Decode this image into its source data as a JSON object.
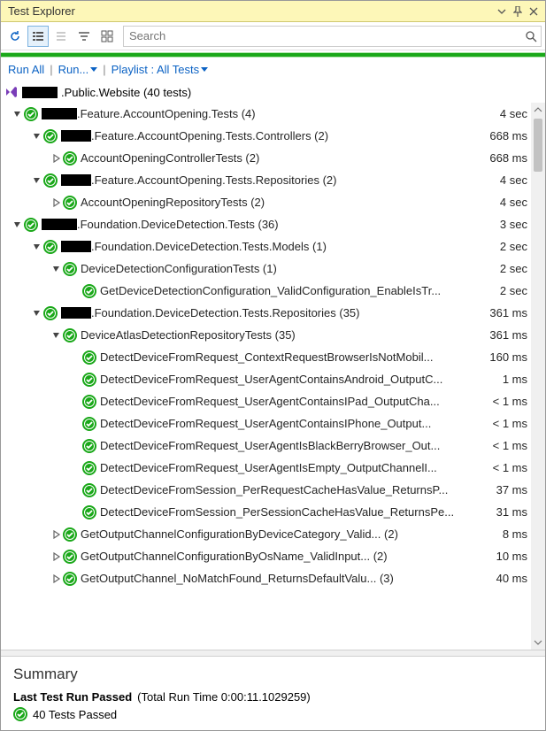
{
  "window": {
    "title": "Test Explorer"
  },
  "search": {
    "placeholder": "Search"
  },
  "linkbar": {
    "runAll": "Run All",
    "run": "Run...",
    "playlist": "Playlist : All Tests"
  },
  "project": {
    "suffix": ".Public.Website (40 tests)"
  },
  "rows": [
    {
      "exp": "open",
      "depth": 0,
      "blackW": 40,
      "text": ".Feature.AccountOpening.Tests (4)",
      "time": "4 sec"
    },
    {
      "exp": "open",
      "depth": 1,
      "blackW": 34,
      "text": ".Feature.AccountOpening.Tests.Controllers (2)",
      "time": "668 ms"
    },
    {
      "exp": "closed",
      "depth": 2,
      "blackW": 0,
      "text": "AccountOpeningControllerTests (2)",
      "time": "668 ms"
    },
    {
      "exp": "open",
      "depth": 1,
      "blackW": 34,
      "text": ".Feature.AccountOpening.Tests.Repositories (2)",
      "time": "4 sec"
    },
    {
      "exp": "closed",
      "depth": 2,
      "blackW": 0,
      "text": "AccountOpeningRepositoryTests (2)",
      "time": "4 sec"
    },
    {
      "exp": "open",
      "depth": 0,
      "blackW": 40,
      "text": ".Foundation.DeviceDetection.Tests (36)",
      "time": "3 sec"
    },
    {
      "exp": "open",
      "depth": 1,
      "blackW": 34,
      "text": ".Foundation.DeviceDetection.Tests.Models (1)",
      "time": "2 sec"
    },
    {
      "exp": "open",
      "depth": 2,
      "blackW": 0,
      "text": "DeviceDetectionConfigurationTests (1)",
      "time": "2 sec"
    },
    {
      "exp": "none",
      "depth": 3,
      "blackW": 0,
      "text": "GetDeviceDetectionConfiguration_ValidConfiguration_EnableIsTr...",
      "time": "2 sec"
    },
    {
      "exp": "open",
      "depth": 1,
      "blackW": 34,
      "text": ".Foundation.DeviceDetection.Tests.Repositories (35)",
      "time": "361 ms"
    },
    {
      "exp": "open",
      "depth": 2,
      "blackW": 0,
      "text": "DeviceAtlasDetectionRepositoryTests (35)",
      "time": "361 ms"
    },
    {
      "exp": "none",
      "depth": 3,
      "blackW": 0,
      "text": "DetectDeviceFromRequest_ContextRequestBrowserIsNotMobil...",
      "time": "160 ms"
    },
    {
      "exp": "none",
      "depth": 3,
      "blackW": 0,
      "text": "DetectDeviceFromRequest_UserAgentContainsAndroid_OutputC...",
      "time": "1 ms"
    },
    {
      "exp": "none",
      "depth": 3,
      "blackW": 0,
      "text": "DetectDeviceFromRequest_UserAgentContainsIPad_OutputCha...",
      "time": "< 1 ms"
    },
    {
      "exp": "none",
      "depth": 3,
      "blackW": 0,
      "text": "DetectDeviceFromRequest_UserAgentContainsIPhone_Output...",
      "time": "< 1 ms"
    },
    {
      "exp": "none",
      "depth": 3,
      "blackW": 0,
      "text": "DetectDeviceFromRequest_UserAgentIsBlackBerryBrowser_Out...",
      "time": "< 1 ms"
    },
    {
      "exp": "none",
      "depth": 3,
      "blackW": 0,
      "text": "DetectDeviceFromRequest_UserAgentIsEmpty_OutputChannelI...",
      "time": "< 1 ms"
    },
    {
      "exp": "none",
      "depth": 3,
      "blackW": 0,
      "text": "DetectDeviceFromSession_PerRequestCacheHasValue_ReturnsP...",
      "time": "37 ms"
    },
    {
      "exp": "none",
      "depth": 3,
      "blackW": 0,
      "text": "DetectDeviceFromSession_PerSessionCacheHasValue_ReturnsPe...",
      "time": "31 ms"
    },
    {
      "exp": "closed",
      "depth": 2,
      "blackW": 0,
      "text": "GetOutputChannelConfigurationByDeviceCategory_Valid... (2)",
      "time": "8 ms"
    },
    {
      "exp": "closed",
      "depth": 2,
      "blackW": 0,
      "text": "GetOutputChannelConfigurationByOsName_ValidInput... (2)",
      "time": "10 ms"
    },
    {
      "exp": "closed",
      "depth": 2,
      "blackW": 0,
      "text": "GetOutputChannel_NoMatchFound_ReturnsDefaultValu... (3)",
      "time": "40 ms"
    }
  ],
  "summary": {
    "heading": "Summary",
    "runBold": "Last Test Run Passed",
    "runRest": " (Total Run Time 0:00:11.1029259)",
    "passed": "40 Tests Passed"
  },
  "scrollbar": {
    "thumbHeight": 60
  }
}
